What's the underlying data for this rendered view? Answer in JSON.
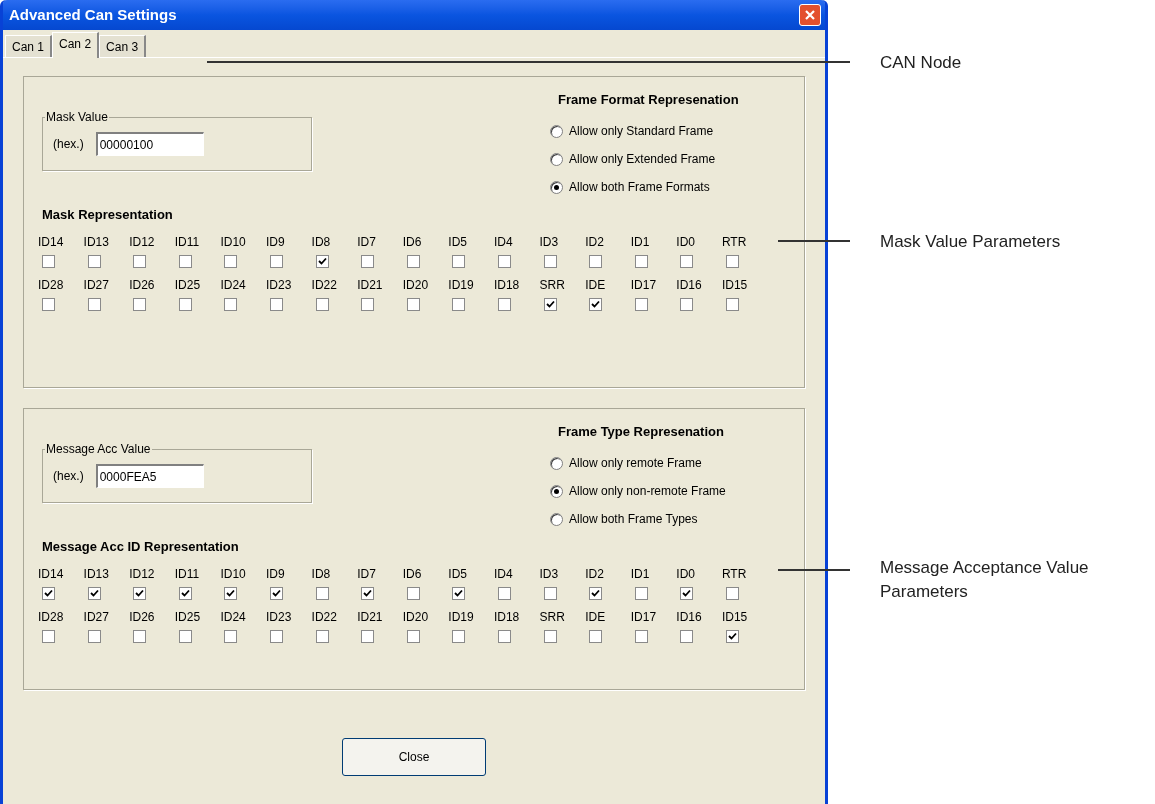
{
  "window": {
    "title": "Advanced Can Settings"
  },
  "tabs": [
    {
      "label": "Can 1",
      "selected": false
    },
    {
      "label": "Can 2",
      "selected": true
    },
    {
      "label": "Can 3",
      "selected": false
    }
  ],
  "groups": [
    {
      "value_box": {
        "label": "Mask Value",
        "unit": "(hex.)",
        "value": "00000100"
      },
      "radio_title": "Frame Format Represenation",
      "radios": [
        {
          "label": "Allow only Standard Frame",
          "selected": false
        },
        {
          "label": "Allow only Extended Frame",
          "selected": false
        },
        {
          "label": "Allow both Frame Formats",
          "selected": true
        }
      ],
      "bits_title": "Mask Representation",
      "rows": [
        [
          {
            "label": "ID14",
            "checked": false
          },
          {
            "label": "ID13",
            "checked": false
          },
          {
            "label": "ID12",
            "checked": false
          },
          {
            "label": "ID11",
            "checked": false
          },
          {
            "label": "ID10",
            "checked": false
          },
          {
            "label": "ID9",
            "checked": false
          },
          {
            "label": "ID8",
            "checked": true
          },
          {
            "label": "ID7",
            "checked": false
          },
          {
            "label": "ID6",
            "checked": false
          },
          {
            "label": "ID5",
            "checked": false
          },
          {
            "label": "ID4",
            "checked": false
          },
          {
            "label": "ID3",
            "checked": false
          },
          {
            "label": "ID2",
            "checked": false
          },
          {
            "label": "ID1",
            "checked": false
          },
          {
            "label": "ID0",
            "checked": false
          },
          {
            "label": "RTR",
            "checked": false
          }
        ],
        [
          {
            "label": "ID28",
            "checked": false
          },
          {
            "label": "ID27",
            "checked": false
          },
          {
            "label": "ID26",
            "checked": false
          },
          {
            "label": "ID25",
            "checked": false
          },
          {
            "label": "ID24",
            "checked": false
          },
          {
            "label": "ID23",
            "checked": false
          },
          {
            "label": "ID22",
            "checked": false
          },
          {
            "label": "ID21",
            "checked": false
          },
          {
            "label": "ID20",
            "checked": false
          },
          {
            "label": "ID19",
            "checked": false
          },
          {
            "label": "ID18",
            "checked": false
          },
          {
            "label": "SRR",
            "checked": true
          },
          {
            "label": "IDE",
            "checked": true
          },
          {
            "label": "ID17",
            "checked": false
          },
          {
            "label": "ID16",
            "checked": false
          },
          {
            "label": "ID15",
            "checked": false
          }
        ]
      ]
    },
    {
      "value_box": {
        "label": "Message Acc Value",
        "unit": "(hex.)",
        "value": "0000FEA5"
      },
      "radio_title": "Frame Type Represenation",
      "radios": [
        {
          "label": "Allow only remote Frame",
          "selected": false
        },
        {
          "label": "Allow only non-remote Frame",
          "selected": true
        },
        {
          "label": "Allow both Frame Types",
          "selected": false
        }
      ],
      "bits_title": "Message Acc ID Representation",
      "rows": [
        [
          {
            "label": "ID14",
            "checked": true
          },
          {
            "label": "ID13",
            "checked": true
          },
          {
            "label": "ID12",
            "checked": true
          },
          {
            "label": "ID11",
            "checked": true
          },
          {
            "label": "ID10",
            "checked": true
          },
          {
            "label": "ID9",
            "checked": true
          },
          {
            "label": "ID8",
            "checked": false
          },
          {
            "label": "ID7",
            "checked": true
          },
          {
            "label": "ID6",
            "checked": false
          },
          {
            "label": "ID5",
            "checked": true
          },
          {
            "label": "ID4",
            "checked": false
          },
          {
            "label": "ID3",
            "checked": false
          },
          {
            "label": "ID2",
            "checked": true
          },
          {
            "label": "ID1",
            "checked": false
          },
          {
            "label": "ID0",
            "checked": true
          },
          {
            "label": "RTR",
            "checked": false
          }
        ],
        [
          {
            "label": "ID28",
            "checked": false
          },
          {
            "label": "ID27",
            "checked": false
          },
          {
            "label": "ID26",
            "checked": false
          },
          {
            "label": "ID25",
            "checked": false
          },
          {
            "label": "ID24",
            "checked": false
          },
          {
            "label": "ID23",
            "checked": false
          },
          {
            "label": "ID22",
            "checked": false
          },
          {
            "label": "ID21",
            "checked": false
          },
          {
            "label": "ID20",
            "checked": false
          },
          {
            "label": "ID19",
            "checked": false
          },
          {
            "label": "ID18",
            "checked": false
          },
          {
            "label": "SRR",
            "checked": false
          },
          {
            "label": "IDE",
            "checked": false
          },
          {
            "label": "ID17",
            "checked": false
          },
          {
            "label": "ID16",
            "checked": false
          },
          {
            "label": "ID15",
            "checked": true
          }
        ]
      ]
    }
  ],
  "close_button": "Close",
  "annotations": [
    "CAN Node",
    "Mask Value Parameters",
    "Message Acceptance Value Parameters"
  ]
}
